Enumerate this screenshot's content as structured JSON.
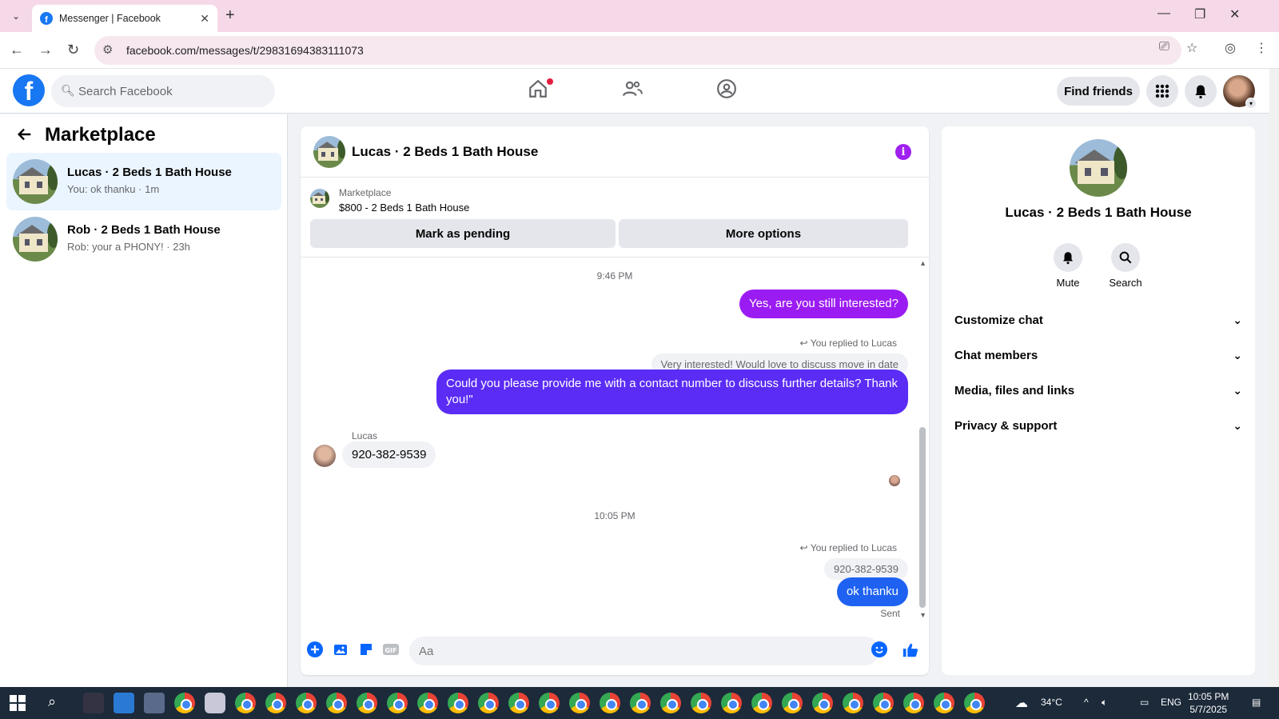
{
  "browser": {
    "tab_title": "Messenger | Facebook",
    "url": "facebook.com/messages/t/29831694383111073"
  },
  "header": {
    "search_placeholder": "Search Facebook",
    "find_friends": "Find friends"
  },
  "sidebar": {
    "title": "Marketplace",
    "conversations": [
      {
        "name": "Lucas · 2 Beds 1 Bath House",
        "preview": "You: ok thanku · 1m",
        "active": true
      },
      {
        "name": "Rob · 2 Beds 1 Bath House",
        "preview": "Rob: your a PHONY! · 23h",
        "active": false
      }
    ]
  },
  "chat": {
    "title": "Lucas · 2 Beds 1 Bath House",
    "marketplace_label": "Marketplace",
    "listing": "$800 - 2 Beds 1 Bath House",
    "mark_pending": "Mark as pending",
    "more_options": "More options",
    "messages": {
      "ts1": "9:46 PM",
      "out1": "Yes, are you still interested?",
      "replied1": "You replied to Lucas",
      "quoted1": "Very interested! Would love to discuss move in date",
      "out2": "Could you please provide me with a contact number to discuss further details? Thank you!\"",
      "sender": "Lucas",
      "in1": "920-382-9539",
      "ts2": "10:05 PM",
      "replied2": "You replied to Lucas",
      "quoted2": "920-382-9539",
      "out3": "ok thanku",
      "sent": "Sent"
    },
    "composer_placeholder": "Aa"
  },
  "details": {
    "name": "Lucas · 2 Beds 1 Bath House",
    "mute": "Mute",
    "search": "Search",
    "sections": [
      "Customize chat",
      "Chat members",
      "Media, files and links",
      "Privacy & support"
    ]
  },
  "taskbar": {
    "weather": "34°C",
    "lang": "ENG",
    "time": "10:05 PM",
    "date": "5/7/2025"
  },
  "colors": {
    "fb_blue": "#1877f2",
    "bubble_purple": "#9b1cf2",
    "bubble_indigo": "#5b2cf5",
    "bubble_blue": "#1f62f2",
    "active_conv": "#ebf5ff"
  }
}
